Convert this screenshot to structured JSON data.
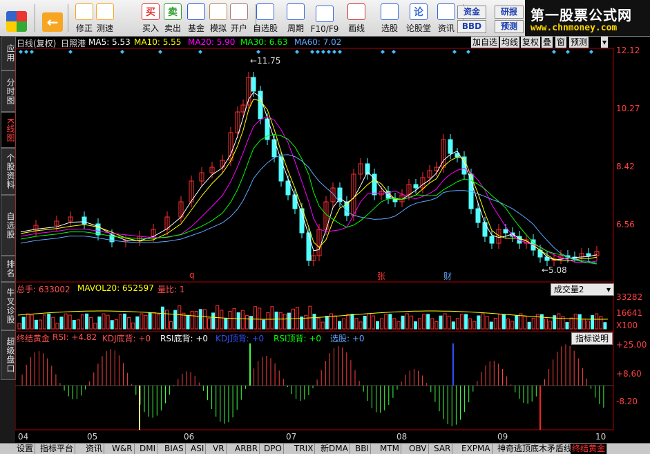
{
  "toolbar": {
    "buttons": [
      {
        "label": "修正",
        "icon": "up-down-arrows-icon"
      },
      {
        "label": "测速",
        "icon": "clock-icon"
      },
      {
        "label": "买入",
        "icon": "buy-icon",
        "glyph": "买"
      },
      {
        "label": "卖出",
        "icon": "sell-icon",
        "glyph": "卖"
      },
      {
        "label": "基金",
        "icon": "fund-icon"
      },
      {
        "label": "模拟",
        "icon": "gavel-icon"
      },
      {
        "label": "开户",
        "icon": "lock-icon"
      },
      {
        "label": "自选股",
        "icon": "star-icon"
      },
      {
        "label": "周期",
        "icon": "period-icon"
      },
      {
        "label": "F10/F9",
        "icon": "f10-icon"
      },
      {
        "label": "画线",
        "icon": "pencil-icon"
      },
      {
        "label": "选股",
        "icon": "select-stock-icon"
      },
      {
        "label": "论股堂",
        "icon": "forum-icon",
        "glyph": "论"
      },
      {
        "label": "资讯",
        "icon": "news-icon"
      }
    ],
    "small_buttons": {
      "capital": "资金",
      "bbd": "BBD",
      "research": "研报",
      "forecast": "预测"
    }
  },
  "logo": {
    "title": "第一股票公式网",
    "url": "www.chnmoney.com"
  },
  "sidebar": {
    "tabs": [
      "应用",
      "分时图",
      "K线图",
      "个股资料",
      "自选股",
      "排名",
      "牛叉诊股",
      "超级盘口"
    ],
    "active": "K线图"
  },
  "header": {
    "period": "日线(复权)",
    "stock": "日照港",
    "ma5": "MA5: 5.53",
    "ma10": "MA10: 5.55",
    "ma20": "MA20: 5.90",
    "ma30": "MA30: 6.63",
    "ma60": "MA60: 7.02",
    "colors": {
      "ma5": "#ffffff",
      "ma10": "#ffff00",
      "ma20": "#ff00ff",
      "ma30": "#00ff00",
      "ma60": "#5fa8ff"
    }
  },
  "right_tools": [
    "加自选",
    "均线",
    "复权",
    "叠",
    "窗",
    "预测"
  ],
  "price_axis": [
    "12.12",
    "10.27",
    "8.42",
    "6.56"
  ],
  "annotations": {
    "high": "11.75",
    "low": "5.08",
    "zhang": "张",
    "cai": "财",
    "q": "q"
  },
  "volume_panel": {
    "total": "总手: 633002",
    "mavol20": "MAVOL20: 652597",
    "ratio": "量比: 1",
    "dropdown": "成交量2",
    "axis": [
      "33282",
      "16641",
      "X100"
    ]
  },
  "indicator_panel": {
    "name": "终结黄金",
    "rsi": "RSI: +4.82",
    "kdj_bottom": "KDJ底背: +0",
    "rsi_bottom": "RSI底背: +0",
    "kdj_top": "KDJ顶背: +0",
    "rsi_top": "RSI顶背: +0",
    "select": "选股: +0",
    "help": "指标说明",
    "axis": [
      "+25.00",
      "+8.60",
      "-8.20"
    ]
  },
  "x_axis": [
    "04",
    "05",
    "06",
    "07",
    "08",
    "09",
    "10"
  ],
  "bottom_tabs": [
    "设置",
    "指标平台",
    "资讯",
    "W&R",
    "DMI",
    "BIAS",
    "ASI",
    "VR",
    "ARBR",
    "DPO",
    "TRIX",
    "新DMA",
    "BBI",
    "MTM",
    "OBV",
    "SAR",
    "EXPMA",
    "神奇逃顶底木矛盾线",
    "终结黄金"
  ],
  "bottom_active": "终结黄金"
}
